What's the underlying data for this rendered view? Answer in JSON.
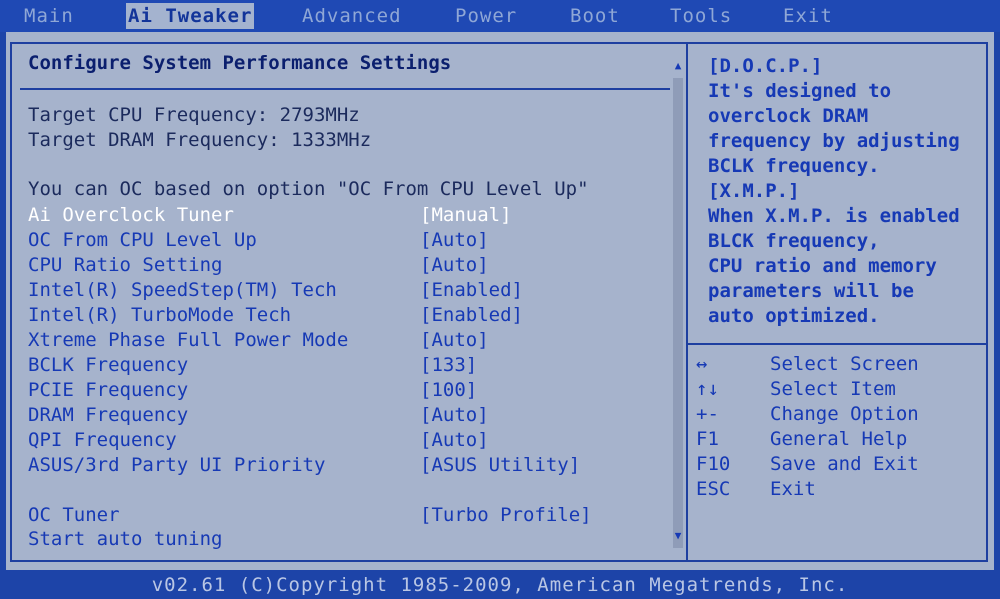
{
  "menu": {
    "items": [
      {
        "label": "Main"
      },
      {
        "label": "Ai Tweaker",
        "active": true
      },
      {
        "label": "Advanced"
      },
      {
        "label": "Power"
      },
      {
        "label": "Boot"
      },
      {
        "label": "Tools"
      },
      {
        "label": "Exit"
      }
    ]
  },
  "panel": {
    "title": "Configure System Performance Settings",
    "target_cpu": "Target CPU Frequency: 2793MHz",
    "target_dram": "Target DRAM Frequency: 1333MHz",
    "note": "You can OC based on option \"OC From CPU Level Up\""
  },
  "settings": [
    {
      "label": "Ai Overclock Tuner",
      "value": "[Manual]",
      "selected": true
    },
    {
      "label": "OC From CPU Level Up",
      "value": "[Auto]"
    },
    {
      "label": "CPU Ratio Setting",
      "value": "[Auto]"
    },
    {
      "label": "Intel(R) SpeedStep(TM) Tech",
      "value": "[Enabled]"
    },
    {
      "label": "Intel(R) TurboMode Tech",
      "value": "[Enabled]"
    },
    {
      "label": "Xtreme Phase Full Power Mode",
      "value": "[Auto]"
    },
    {
      "label": "BCLK Frequency",
      "value": "[133]"
    },
    {
      "label": "PCIE Frequency",
      "value": "[100]"
    },
    {
      "label": "DRAM Frequency",
      "value": "[Auto]"
    },
    {
      "label": "QPI Frequency",
      "value": "[Auto]"
    },
    {
      "label": "ASUS/3rd Party UI Priority",
      "value": "[ASUS Utility]"
    }
  ],
  "tuner": [
    {
      "label": "OC Tuner",
      "value": "[Turbo Profile]"
    },
    {
      "label": "Start auto tuning",
      "value": ""
    }
  ],
  "scroll": {
    "up_icon": "▲",
    "down_icon": "▼"
  },
  "help": {
    "lines": [
      "[D.O.C.P.]",
      "It's designed to",
      "overclock DRAM",
      "frequency by adjusting",
      "BCLK frequency.",
      "[X.M.P.]",
      "When X.M.P. is enabled",
      "BLCK frequency,",
      "CPU ratio and memory",
      "parameters will be",
      "auto optimized."
    ]
  },
  "keys": [
    {
      "key": "↔",
      "desc": "Select Screen"
    },
    {
      "key": "↑↓",
      "desc": "Select Item"
    },
    {
      "key": "+-",
      "desc": "Change Option"
    },
    {
      "key": "F1",
      "desc": "General Help"
    },
    {
      "key": "F10",
      "desc": "Save and Exit"
    },
    {
      "key": "ESC",
      "desc": "Exit"
    }
  ],
  "footer": {
    "text": "v02.61 (C)Copyright 1985-2009, American Megatrends, Inc."
  },
  "colors": {
    "background": "#1d44a8",
    "panel": "#a6b3cc",
    "text": "#1639b5",
    "selected": "#ffffff"
  }
}
